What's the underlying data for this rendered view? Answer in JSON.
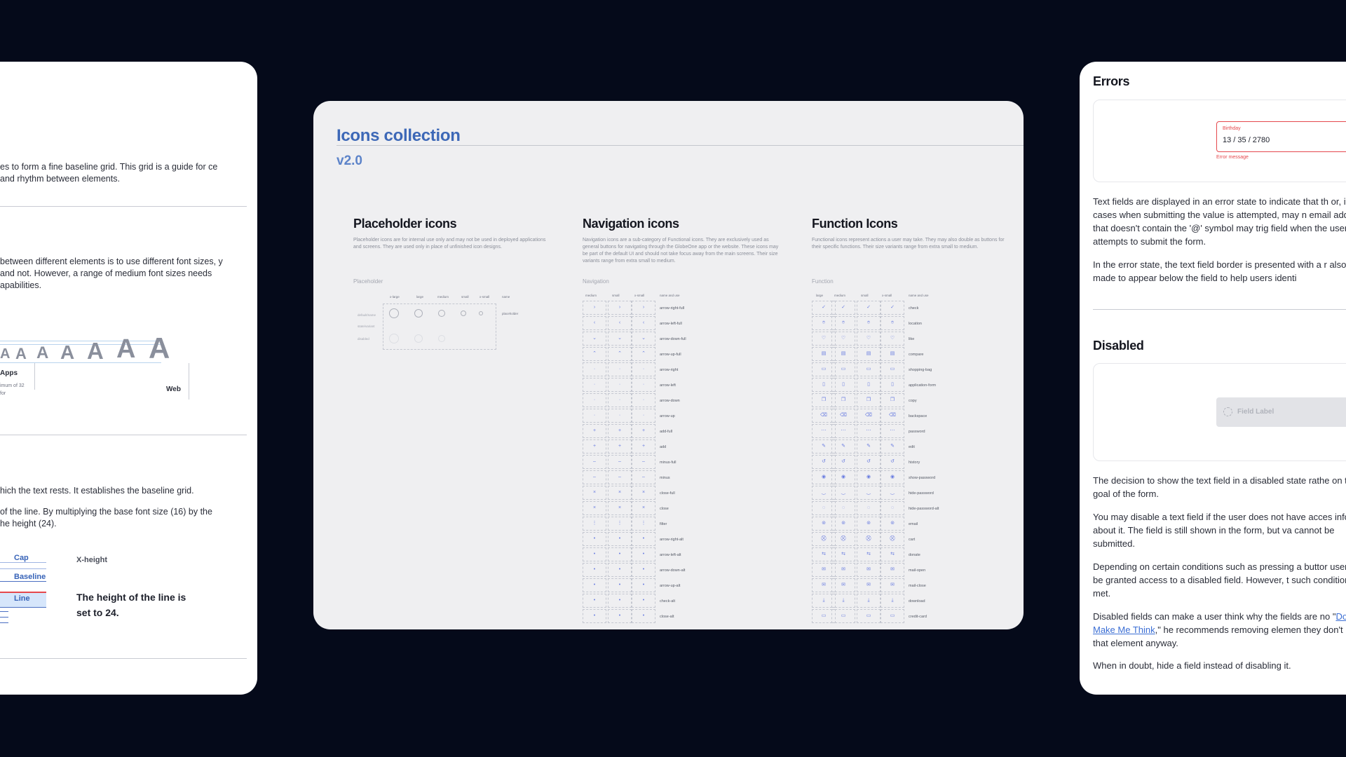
{
  "left_card": {
    "p1": "es to form a fine baseline grid. This grid is a guide for ce and rhythm between elements.",
    "p2": "between different elements is to use different font sizes, y and not. However, a range of medium font sizes needs apabilities.",
    "glyph": "A",
    "apps_label": "Apps",
    "apps_note": "imum of 32 for",
    "web_label": "Web",
    "p3": "hich the text rests. It establishes the baseline grid.",
    "p4": "of the line. By multiplying the base font size (16) by the he height (24).",
    "cap_label": "Cap",
    "xheight_label": "X-height",
    "baseline_label": "Baseline",
    "line_label": "Line",
    "line_note": "The height of the line is set to 24."
  },
  "center_card": {
    "title": "Icons collection",
    "version": "v2.0",
    "placeholder": {
      "heading": "Placeholder icons",
      "desc": "Placeholder icons are for internal use only and may not be used in deployed applications and screens. They are used only in place of unfinished icon designs.",
      "label": "Placeholder",
      "columns": [
        "x-large",
        "large",
        "medium",
        "small",
        "x-small",
        "name"
      ],
      "rows": [
        "default/name",
        "state/variant",
        "disabled"
      ],
      "icon_name": "placeholder"
    },
    "navigation": {
      "heading": "Navigation icons",
      "desc": "Navigation icons are a sub-category of Functional icons. They are exclusively used as general buttons for navigating through the GlobeOne app or the website. These icons may be part of the default UI and should not take focus away from the main screens. Their size variants range from extra small to medium.",
      "label": "Navigation",
      "columns": [
        "medium",
        "small",
        "x-small",
        "name and use"
      ],
      "icons": [
        "arrow-right-full",
        "arrow-left-full",
        "arrow-down-full",
        "arrow-up-full",
        "arrow-right",
        "arrow-left",
        "arrow-down",
        "arrow-up",
        "add-full",
        "add",
        "minus-full",
        "minus",
        "close-full",
        "close",
        "filter",
        "arrow-right-alt",
        "arrow-left-alt",
        "arrow-down-alt",
        "arrow-up-alt",
        "check-alt",
        "close-alt"
      ],
      "glyphs": [
        "›",
        "‹",
        "⌄",
        "⌃",
        "·",
        "·",
        "·",
        "·",
        "+",
        "+",
        "–",
        "–",
        "×",
        "×",
        "⋮",
        "•",
        "•",
        "•",
        "•",
        "•",
        "•"
      ]
    },
    "function": {
      "heading": "Function Icons",
      "desc": "Functional icons represent actions a user may take. They may also double as buttons for their specific functions. Their size variants range from extra small to medium.",
      "label": "Function",
      "columns": [
        "large",
        "medium",
        "small",
        "x-small",
        "name and use"
      ],
      "icons": [
        "check",
        "location",
        "like",
        "compare",
        "shopping-bag",
        "application-form",
        "copy",
        "backspace",
        "password",
        "edit",
        "history",
        "show-password",
        "hide-password",
        "hide-password-alt",
        "email",
        "cart",
        "donate",
        "mail-open",
        "mail-close",
        "download",
        "credit-card"
      ],
      "glyphs": [
        "✓",
        "⌾",
        "♡",
        "▤",
        "▭",
        "▯",
        "❐",
        "⌫",
        "⋯",
        "✎",
        "↺",
        "◉",
        "‿",
        "◌",
        "⊚",
        "⛒",
        "⇆",
        "✉",
        "✉",
        "⤓",
        "▭"
      ]
    }
  },
  "right_card": {
    "errors_heading": "Errors",
    "field_label": "Birthday",
    "field_value": "13 / 35 / 2780",
    "error_message": "Error message",
    "error_p1": "Text fields are displayed in an error state to indicate that th or, in cases when submitting the value is attempted, may n email address that doesn't contain the '@' symbol may trig field when the user attempts to submit the form.",
    "error_p2": "In the error state, the text field border is presented with a r also be made to appear below the field to help users identi",
    "disabled_heading": "Disabled",
    "disabled_field_label": "Field Label",
    "disabled_p1": "The decision to show the text field in a disabled state rathe on the goal of the form.",
    "disabled_p2": "You may disable a text field if the user does not have acces informed about it. The field is still shown in the form, but va cannot be submitted.",
    "disabled_p3": "Depending on certain conditions such as pressing a buttor user may be granted access to a disabled field. However, t such conditions are met.",
    "disabled_p4_start": "Disabled fields can make a user think why the fields are no",
    "disabled_p4_quote_open": "\"",
    "disabled_p4_link": "Don't Make Me Think",
    "disabled_p4_end": ",\" he recommends removing elemen they don't need that element anyway.",
    "disabled_p5": "When in doubt, hide a field instead of disabling it."
  },
  "colors": {
    "background": "#050a1a",
    "accent": "#3d68b7",
    "error": "#e5484d",
    "link": "#3b6ed4"
  }
}
